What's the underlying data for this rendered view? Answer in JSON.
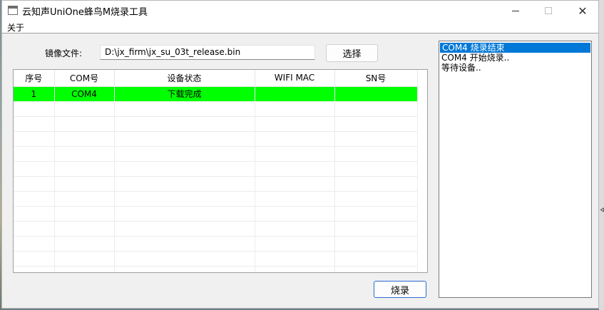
{
  "window": {
    "title": "云知声UniOne蜂鸟M烧录工具",
    "close_glyph": "✕"
  },
  "menu": {
    "about": "关于"
  },
  "file": {
    "label": "镜像文件:",
    "path": "D:\\jx_firm\\jx_su_03t_release.bin",
    "select_button": "选择"
  },
  "table": {
    "headers": [
      "序号",
      "COM号",
      "设备状态",
      "WIFI MAC",
      "SN号"
    ],
    "rows": [
      {
        "index": "1",
        "com": "COM4",
        "status": "下载完成",
        "mac": "",
        "sn": ""
      }
    ],
    "active_row_color": "#00ff00"
  },
  "burn_button": "烧录",
  "log": {
    "items": [
      "COM4 烧录结束",
      "COM4 开始烧录..",
      "等待设备.."
    ],
    "selected_index": 0,
    "selection_color": "#0078d7"
  },
  "icons": {
    "app": "app-window-icon",
    "minimize": "minimize-icon",
    "maximize": "maximize-icon",
    "close": "close-icon"
  }
}
